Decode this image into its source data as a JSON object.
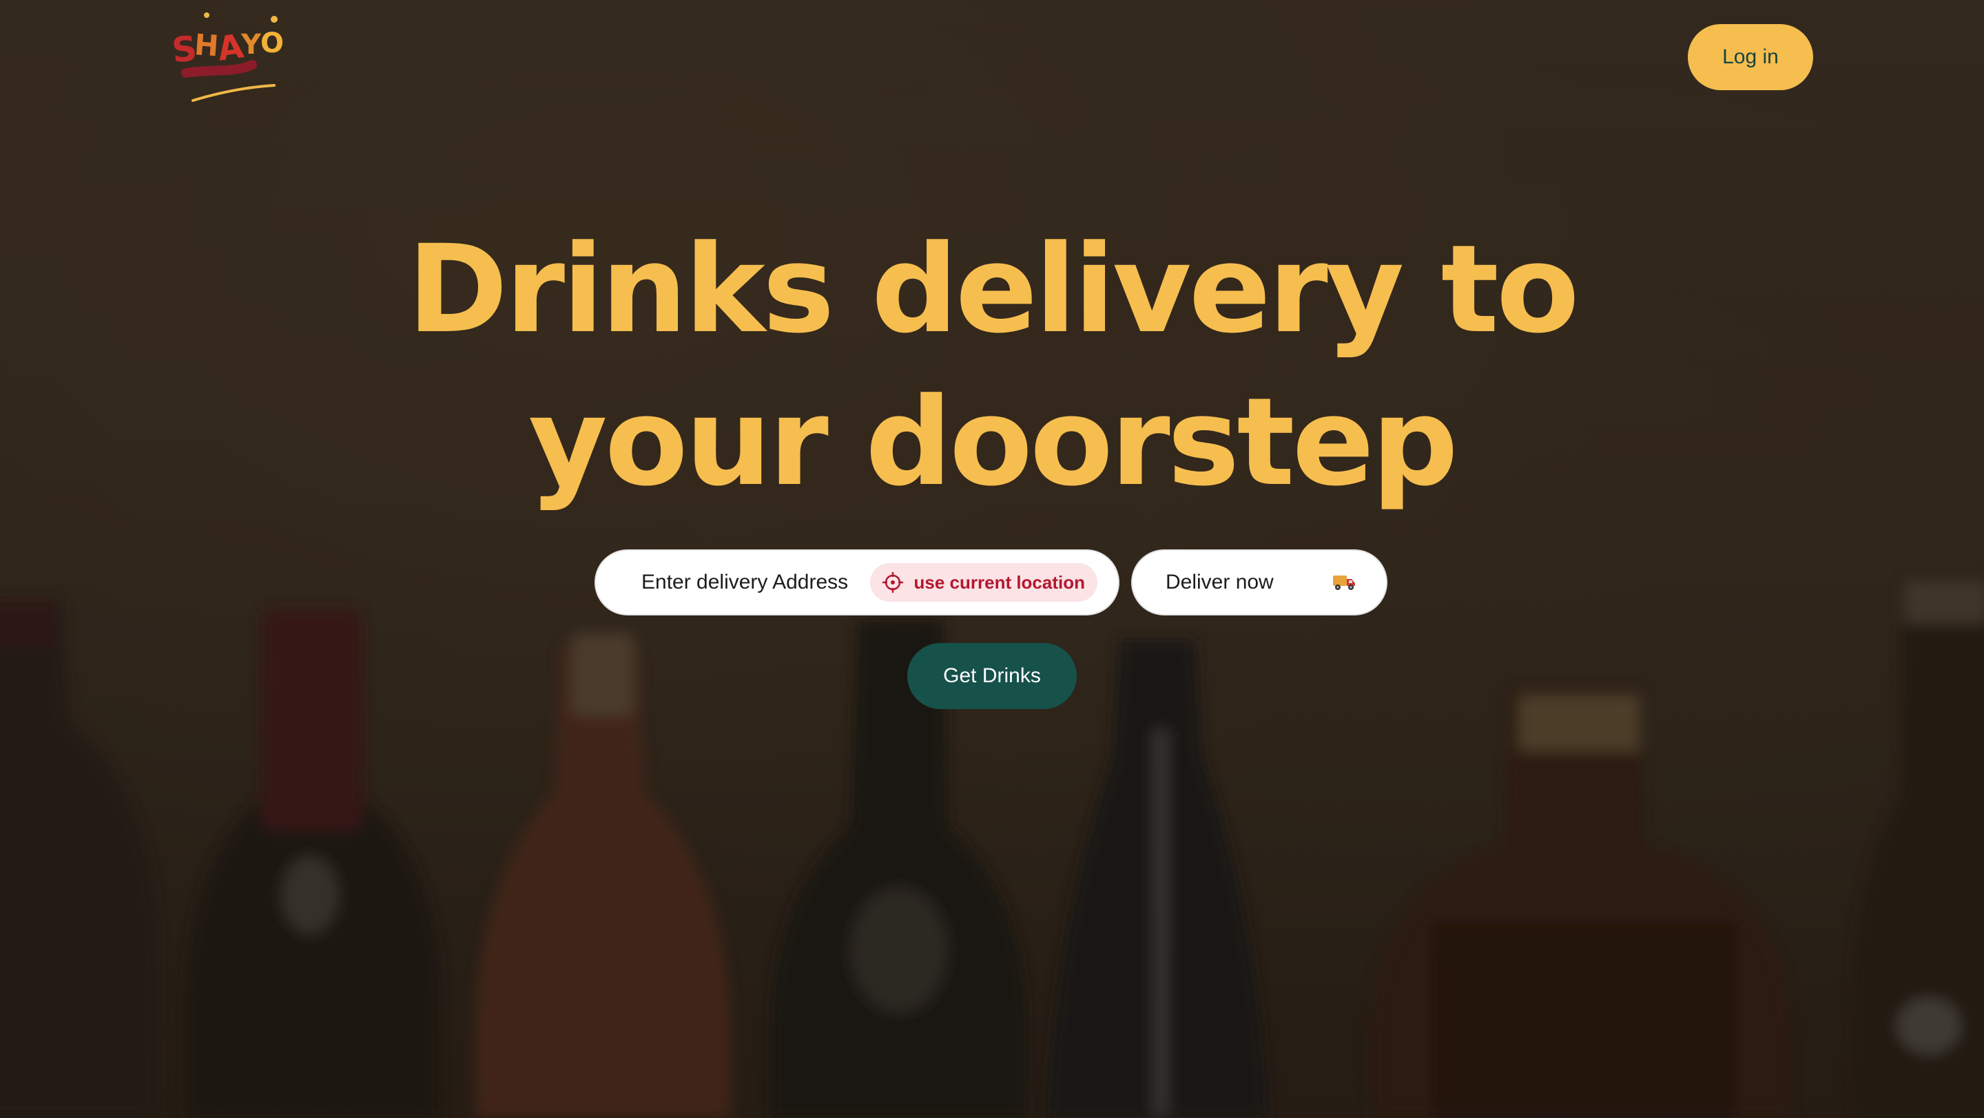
{
  "brand": {
    "logo_alt": "SHAYO"
  },
  "header": {
    "login_label": "Log in"
  },
  "hero": {
    "title_line1": "Drinks delivery to",
    "title_line2": "your doorstep"
  },
  "search": {
    "address_placeholder": "Enter delivery Address",
    "use_location_label": "use current location",
    "delivery_time_label": "Deliver now",
    "submit_label": "Get Drinks"
  },
  "colors": {
    "accent_yellow": "#f6be4f",
    "brand_green": "#16514a",
    "location_red": "#b5172f",
    "location_chip_bg": "#fbe3e6"
  },
  "icons": {
    "location": "crosshair-icon",
    "delivery": "truck-icon"
  }
}
